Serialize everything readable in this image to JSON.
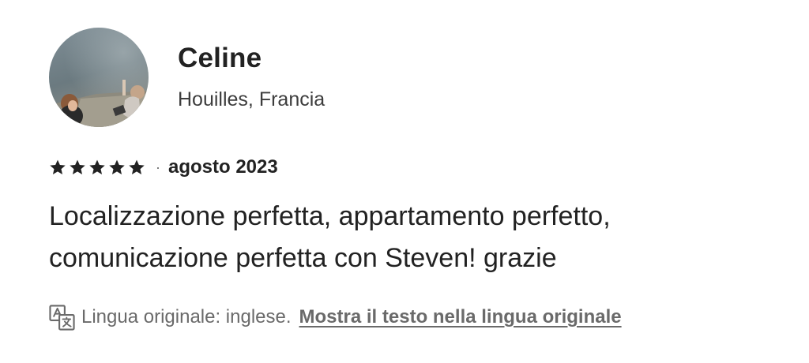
{
  "reviewer": {
    "name": "Celine",
    "location": "Houilles, Francia",
    "avatar_icon": "reviewer-photo"
  },
  "review": {
    "rating": 5,
    "rating_max": 5,
    "star_icon": "star-icon",
    "separator": "·",
    "date": "agosto 2023",
    "text": "Localizzazione perfetta, appartamento perfetto, comunicazione perfetta con Steven! grazie"
  },
  "translation": {
    "icon": "translate-icon",
    "note": "Lingua originale: inglese.",
    "link_label": "Mostra il testo nella lingua originale"
  },
  "colors": {
    "text_primary": "#222222",
    "text_secondary": "#6a6a6a",
    "background": "#ffffff"
  }
}
